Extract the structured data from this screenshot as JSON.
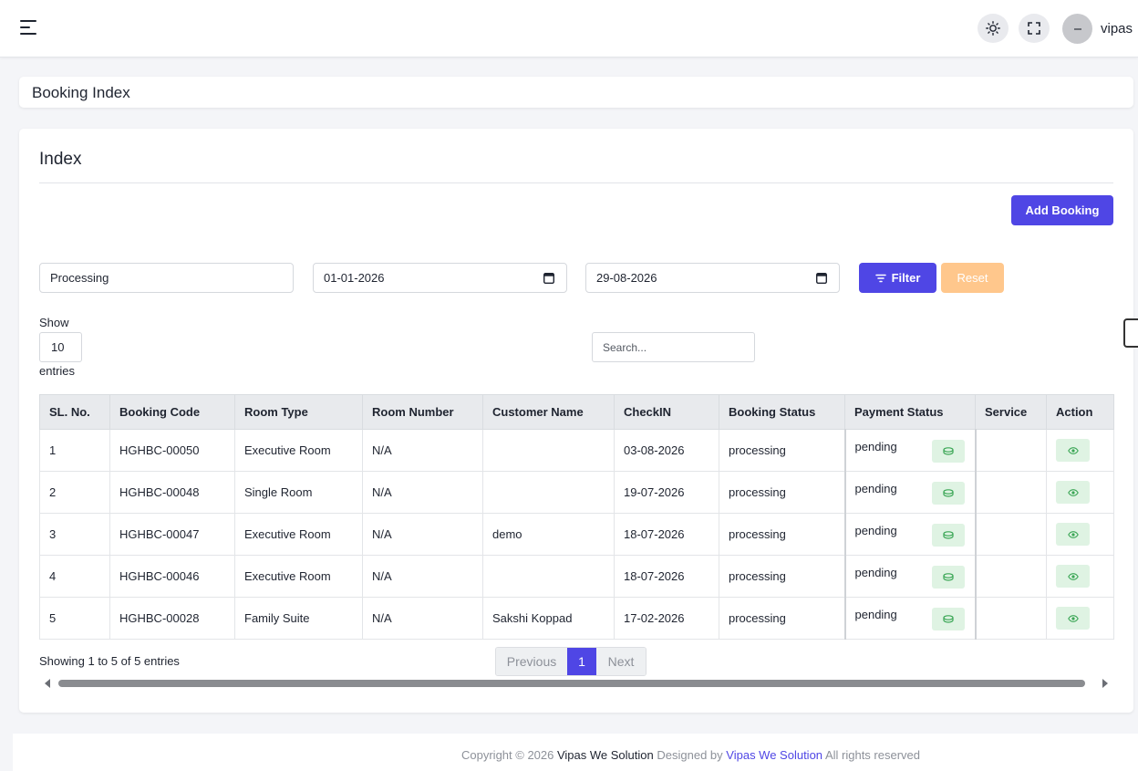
{
  "header": {
    "username": "vipas",
    "icons": [
      "menu-icon",
      "sun-icon",
      "fullscreen-icon",
      "avatar"
    ]
  },
  "breadcrumb": {
    "title": "Booking Index"
  },
  "card": {
    "title": "Index",
    "add_button_label": "Add Booking"
  },
  "filters": {
    "status_value": "Processing",
    "from_date": "01-01-2026",
    "to_date": "29-08-2026",
    "filter_label": "Filter",
    "reset_label": "Reset"
  },
  "length": {
    "show_label": "Show",
    "value": "10",
    "entries_label": "entries"
  },
  "search": {
    "placeholder": "Search..."
  },
  "table": {
    "headers": [
      "SL. No.",
      "Booking Code",
      "Room Type",
      "Room Number",
      "Customer Name",
      "CheckIN",
      "Booking Status",
      "Payment Status",
      "Service",
      "Action"
    ],
    "rows": [
      {
        "sl": "1",
        "code": "HGHBC-00050",
        "room_type": "Executive Room",
        "room_number": "N/A",
        "customer": "",
        "checkin": "03-08-2026",
        "status": "processing",
        "payment": "pending",
        "service": ""
      },
      {
        "sl": "2",
        "code": "HGHBC-00048",
        "room_type": "Single Room",
        "room_number": "N/A",
        "customer": "",
        "checkin": "19-07-2026",
        "status": "processing",
        "payment": "pending",
        "service": ""
      },
      {
        "sl": "3",
        "code": "HGHBC-00047",
        "room_type": "Executive Room",
        "room_number": "N/A",
        "customer": "demo",
        "checkin": "18-07-2026",
        "status": "processing",
        "payment": "pending",
        "service": ""
      },
      {
        "sl": "4",
        "code": "HGHBC-00046",
        "room_type": "Executive Room",
        "room_number": "N/A",
        "customer": "",
        "checkin": "18-07-2026",
        "status": "processing",
        "payment": "pending",
        "service": ""
      },
      {
        "sl": "5",
        "code": "HGHBC-00028",
        "room_type": "Family Suite",
        "room_number": "N/A",
        "customer": "Sakshi Koppad",
        "checkin": "17-02-2026",
        "status": "processing",
        "payment": "pending",
        "service": ""
      }
    ]
  },
  "pagination": {
    "info": "Showing 1 to 5 of 5 entries",
    "previous": "Previous",
    "current": "1",
    "next": "Next"
  },
  "footer": {
    "prefix": "Copyright © 2026",
    "brand": "Vipas We Solution",
    "designed_by": "Designed by",
    "link": "Vipas We Solution",
    "suffix": "All rights reserved"
  },
  "colors": {
    "primary": "#4f46e5",
    "reset": "#ffc78c",
    "success_bg": "#dff3e3",
    "success_icon": "#3aa655"
  }
}
